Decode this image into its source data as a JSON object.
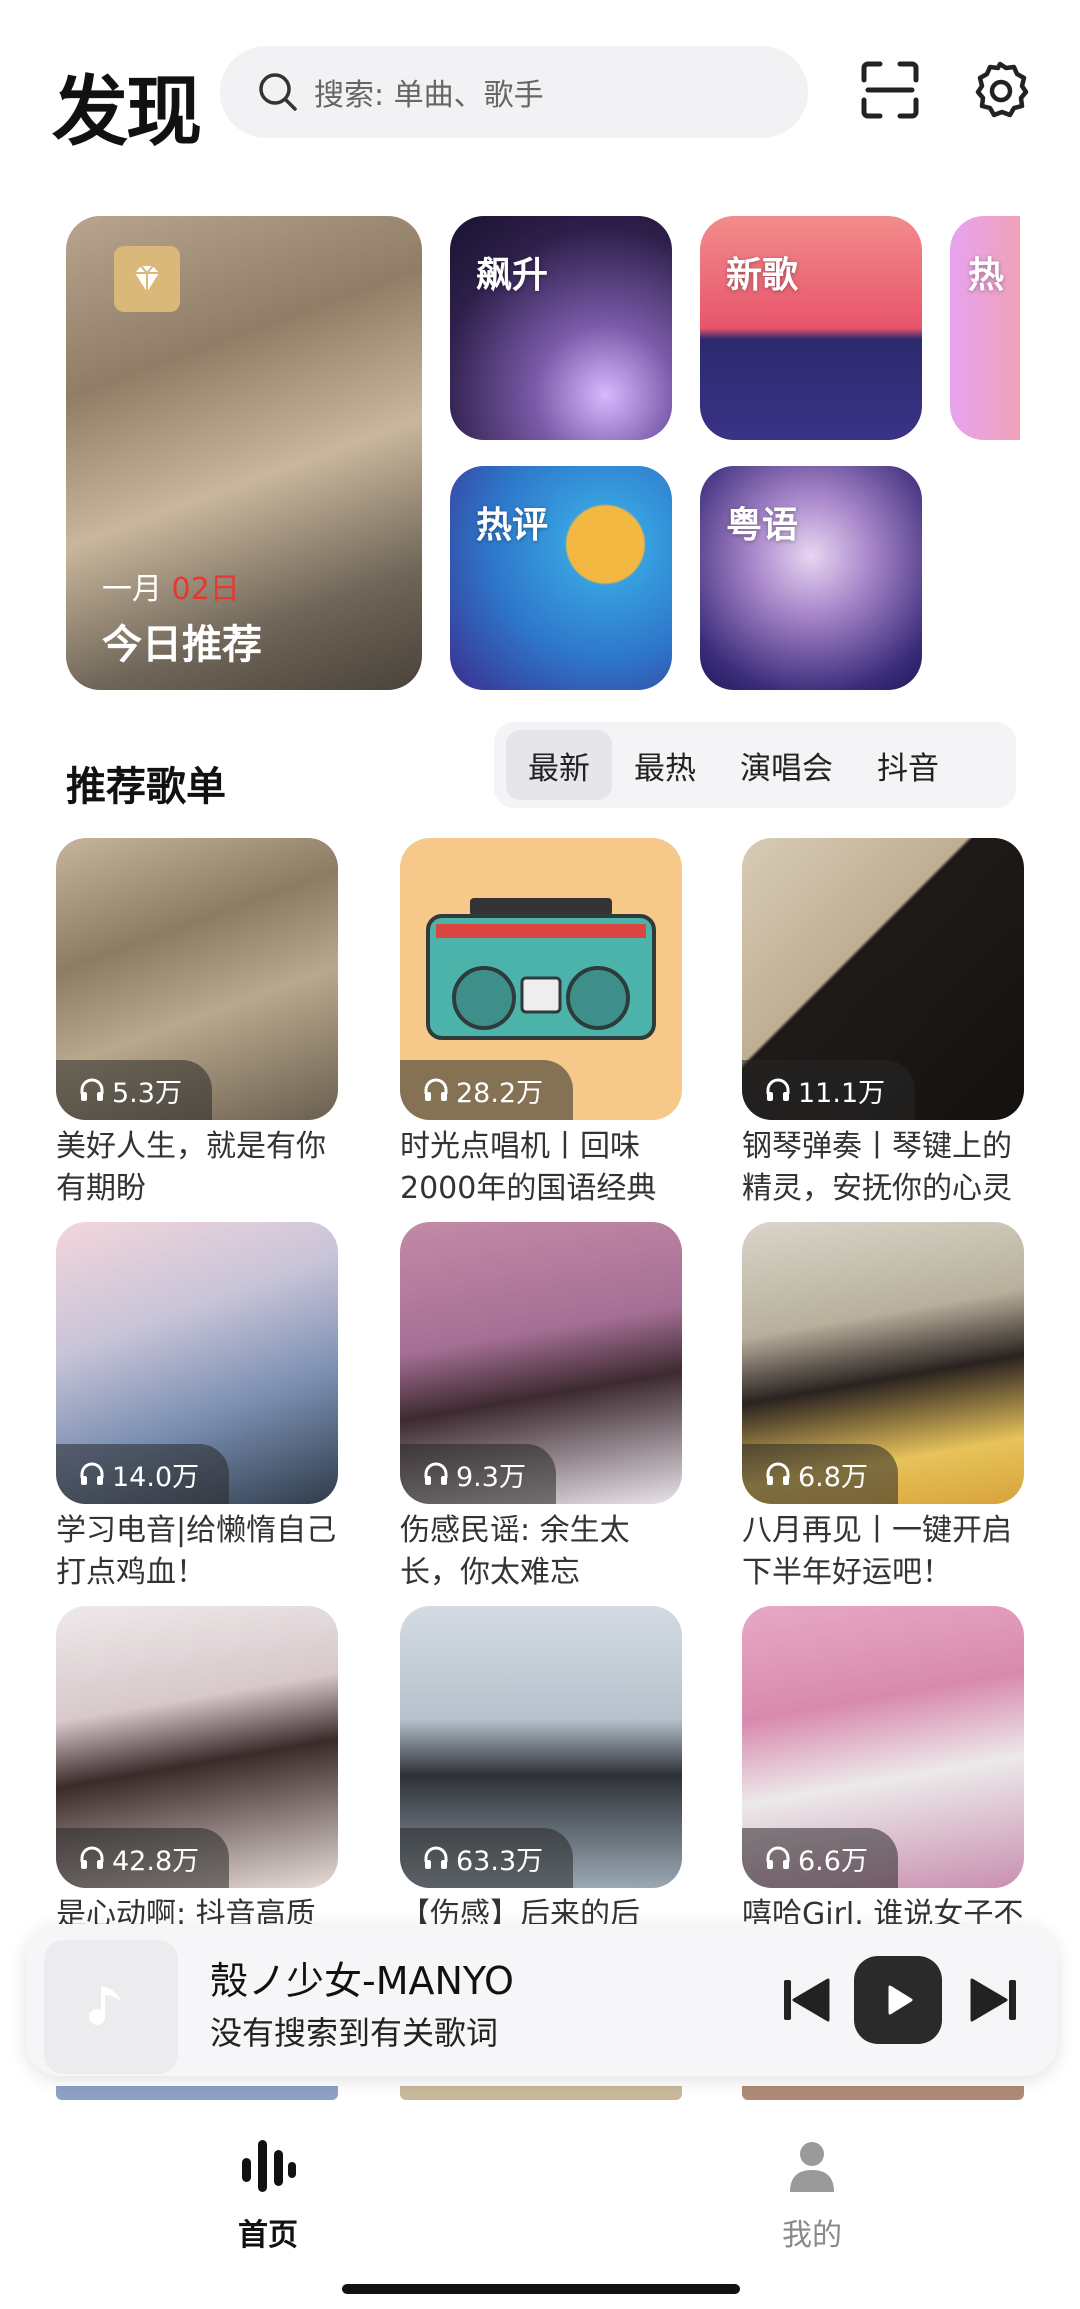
{
  "header": {
    "title": "发现",
    "search_placeholder": "搜索: 单曲、歌手"
  },
  "tiles": {
    "daily": {
      "month": "一月",
      "day": "02日",
      "title": "今日推荐"
    },
    "rise": "飙升",
    "new": "新歌",
    "hot": "热",
    "review": "热评",
    "canto": "粤语"
  },
  "section": {
    "title": "推荐歌单",
    "tabs": [
      "最新",
      "最热",
      "演唱会",
      "抖音"
    ],
    "active_tab": "最新"
  },
  "playlists": [
    {
      "plays": "5.3万",
      "caption": "美好人生，就是有你有期盼"
    },
    {
      "plays": "28.2万",
      "caption": "时光点唱机丨回味2000年的国语经典"
    },
    {
      "plays": "11.1万",
      "caption": "钢琴弹奏丨琴键上的精灵，安抚你的心灵"
    },
    {
      "plays": "14.0万",
      "caption": "学习电音|给懒惰自己打点鸡血！"
    },
    {
      "plays": "9.3万",
      "caption": "伤感民谣: 余生太长，你太难忘"
    },
    {
      "plays": "6.8万",
      "caption": "八月再见丨一键开启下半年好运吧！"
    },
    {
      "plays": "42.8万",
      "caption": "是心动啊: 抖音高质"
    },
    {
      "plays": "63.3万",
      "caption": "【伤感】后来的后"
    },
    {
      "plays": "6.6万",
      "caption": "嘻哈Girl. 谁说女子不"
    }
  ],
  "player": {
    "title": "殼ノ少女-MANYO",
    "subtitle": "没有搜索到有关歌词"
  },
  "nav": {
    "home": "首页",
    "me": "我的"
  },
  "colors": {
    "accent_red": "#e8372f",
    "text_primary": "#111111",
    "nav_inactive": "#8a8a8a"
  }
}
